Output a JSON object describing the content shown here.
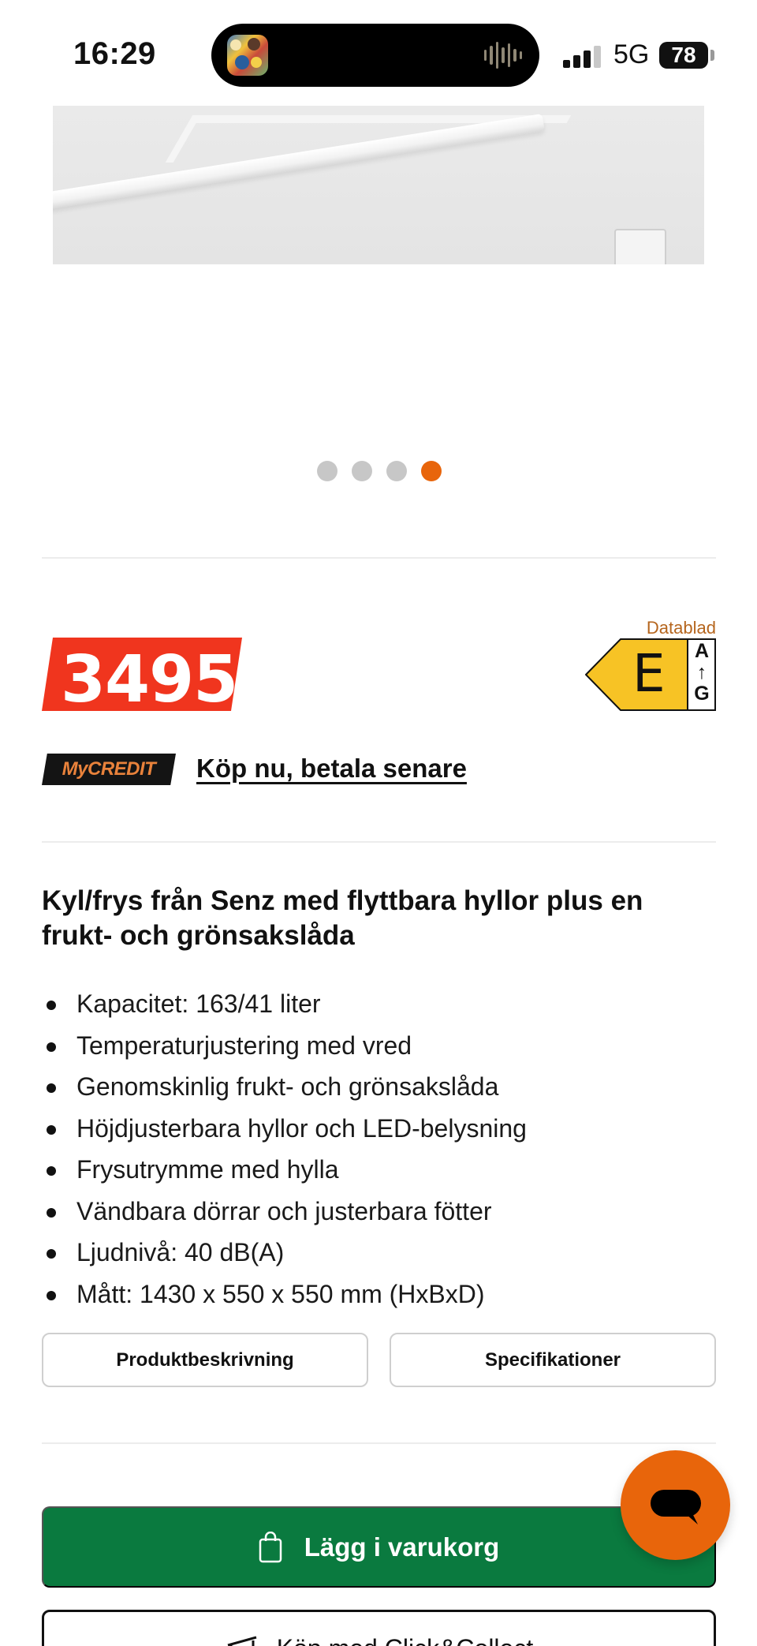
{
  "status_bar": {
    "time": "16:29",
    "network": "5G",
    "battery": "78"
  },
  "carousel": {
    "dots": 4,
    "active_index": 3,
    "active_color": "#e8650b",
    "inactive_color": "#c7c7c7"
  },
  "price": {
    "amount": "3495",
    "tag_color": "#f0351e"
  },
  "energy": {
    "datablad_label": "Datablad",
    "class": "E",
    "scale_top": "A",
    "scale_arrow": "↑",
    "scale_bottom": "G",
    "color": "#f7c325"
  },
  "financing": {
    "badge": "MyCREDIT",
    "link": "Köp nu, betala senare"
  },
  "product": {
    "heading": "Kyl/frys från Senz med flyttbara hyllor plus en frukt- och grönsakslåda",
    "features": [
      "Kapacitet: 163/41 liter",
      "Temperaturjustering med vred",
      "Genomskinlig frukt- och grönsakslåda",
      "Höjdjusterbara hyllor och LED-belysning",
      "Frysutrymme med hylla",
      "Vändbara dörrar och justerbara fötter",
      "Ljudnivå: 40 dB(A)",
      "Mått: 1430 x 550 x 550 mm (HxBxD)"
    ]
  },
  "buttons": {
    "description": "Produktbeskrivning",
    "specifications": "Specifikationer",
    "add_to_cart": "Lägg i varukorg",
    "click_collect": "Köp med Click&Collect"
  },
  "colors": {
    "cart_green": "#0a7a3f",
    "accent_orange": "#e8650b"
  }
}
